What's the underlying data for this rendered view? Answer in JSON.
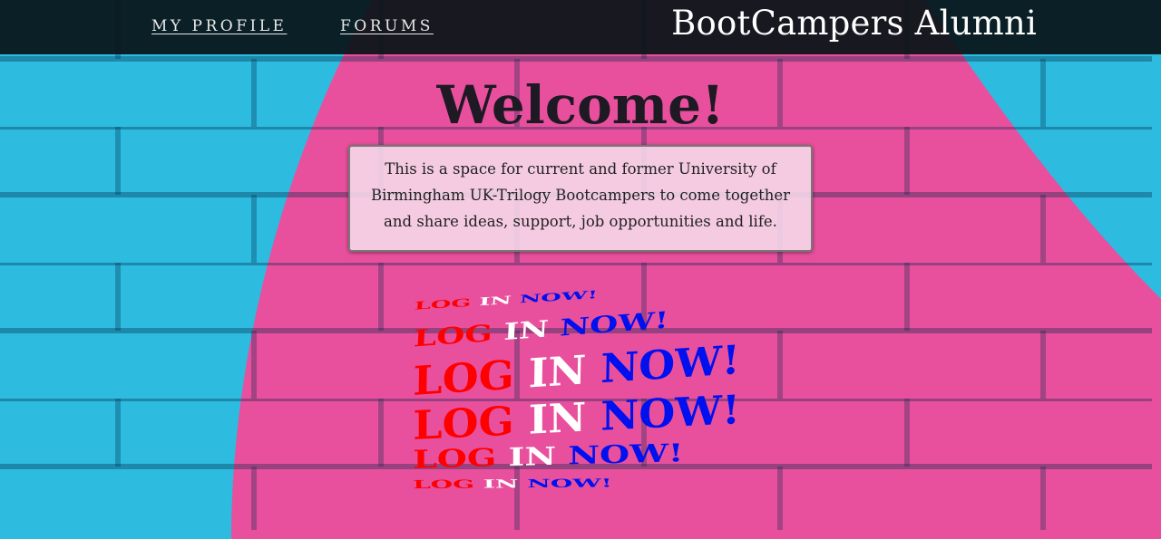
{
  "nav": {
    "links": [
      {
        "label": "MY PROFILE"
      },
      {
        "label": "FORUMS"
      }
    ],
    "brand": "BootCampers Alumni"
  },
  "main": {
    "heading": "Welcome!",
    "intro": "This is a space for current and former University of Birmingham UK-Trilogy Bootcampers to come together and share ideas, support, job opportunities and life.",
    "login_banner": {
      "word1": "LOG",
      "word2": "IN",
      "word3": "NOW!",
      "colors": {
        "word1": "#ff0000",
        "word2": "#ffffff",
        "word3": "#0010ee"
      }
    }
  },
  "colors": {
    "wall_blue": "#2dbbe0",
    "wall_pink": "#e8509e",
    "nav_bg": "#081418"
  }
}
